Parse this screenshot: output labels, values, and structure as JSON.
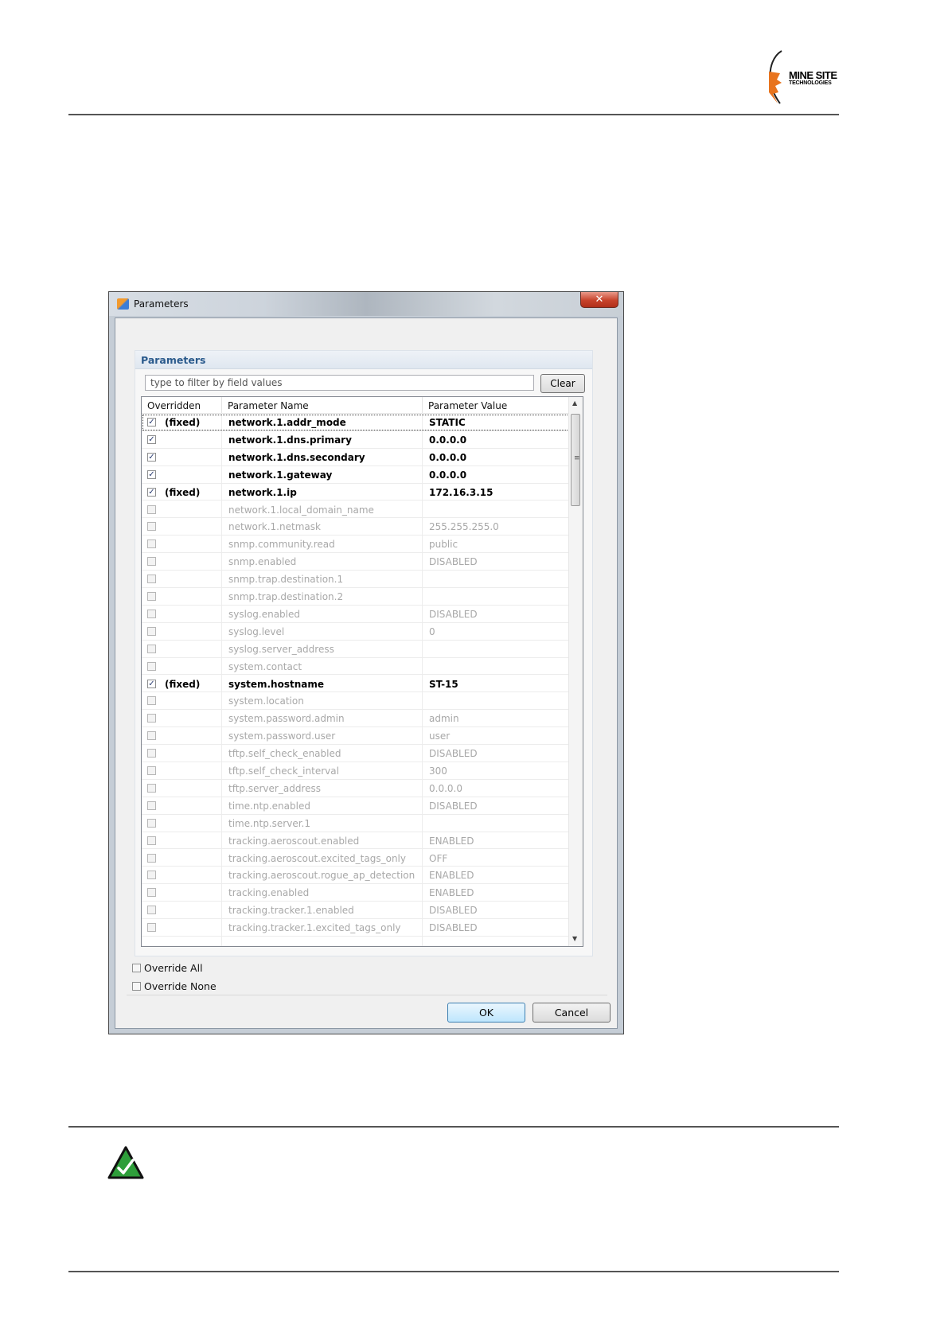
{
  "logo": {
    "line1": "MINE SITE",
    "line2": "TECHNOLOGIES"
  },
  "dialog": {
    "window_title": "Parameters",
    "close_glyph": "✕",
    "panel_title": "Parameters",
    "filter_placeholder": "type to filter by field values",
    "clear_label": "Clear",
    "columns": [
      "Overridden",
      "Parameter Name",
      "Parameter Value"
    ],
    "rows": [
      {
        "checked": true,
        "fixed": "(fixed)",
        "name": "network.1.addr_mode",
        "value": "STATIC"
      },
      {
        "checked": true,
        "fixed": "",
        "name": "network.1.dns.primary",
        "value": "0.0.0.0"
      },
      {
        "checked": true,
        "fixed": "",
        "name": "network.1.dns.secondary",
        "value": "0.0.0.0"
      },
      {
        "checked": true,
        "fixed": "",
        "name": "network.1.gateway",
        "value": "0.0.0.0"
      },
      {
        "checked": true,
        "fixed": "(fixed)",
        "name": "network.1.ip",
        "value": "172.16.3.15"
      },
      {
        "checked": false,
        "fixed": "",
        "name": "network.1.local_domain_name",
        "value": ""
      },
      {
        "checked": false,
        "fixed": "",
        "name": "network.1.netmask",
        "value": "255.255.255.0"
      },
      {
        "checked": false,
        "fixed": "",
        "name": "snmp.community.read",
        "value": "public"
      },
      {
        "checked": false,
        "fixed": "",
        "name": "snmp.enabled",
        "value": "DISABLED"
      },
      {
        "checked": false,
        "fixed": "",
        "name": "snmp.trap.destination.1",
        "value": ""
      },
      {
        "checked": false,
        "fixed": "",
        "name": "snmp.trap.destination.2",
        "value": ""
      },
      {
        "checked": false,
        "fixed": "",
        "name": "syslog.enabled",
        "value": "DISABLED"
      },
      {
        "checked": false,
        "fixed": "",
        "name": "syslog.level",
        "value": "0"
      },
      {
        "checked": false,
        "fixed": "",
        "name": "syslog.server_address",
        "value": ""
      },
      {
        "checked": false,
        "fixed": "",
        "name": "system.contact",
        "value": ""
      },
      {
        "checked": true,
        "fixed": "(fixed)",
        "name": "system.hostname",
        "value": "ST-15"
      },
      {
        "checked": false,
        "fixed": "",
        "name": "system.location",
        "value": ""
      },
      {
        "checked": false,
        "fixed": "",
        "name": "system.password.admin",
        "value": "admin"
      },
      {
        "checked": false,
        "fixed": "",
        "name": "system.password.user",
        "value": "user"
      },
      {
        "checked": false,
        "fixed": "",
        "name": "tftp.self_check_enabled",
        "value": "DISABLED"
      },
      {
        "checked": false,
        "fixed": "",
        "name": "tftp.self_check_interval",
        "value": "300"
      },
      {
        "checked": false,
        "fixed": "",
        "name": "tftp.server_address",
        "value": "0.0.0.0"
      },
      {
        "checked": false,
        "fixed": "",
        "name": "time.ntp.enabled",
        "value": "DISABLED"
      },
      {
        "checked": false,
        "fixed": "",
        "name": "time.ntp.server.1",
        "value": ""
      },
      {
        "checked": false,
        "fixed": "",
        "name": "tracking.aeroscout.enabled",
        "value": "ENABLED"
      },
      {
        "checked": false,
        "fixed": "",
        "name": "tracking.aeroscout.excited_tags_only",
        "value": "OFF"
      },
      {
        "checked": false,
        "fixed": "",
        "name": "tracking.aeroscout.rogue_ap_detection",
        "value": "ENABLED"
      },
      {
        "checked": false,
        "fixed": "",
        "name": "tracking.enabled",
        "value": "ENABLED"
      },
      {
        "checked": false,
        "fixed": "",
        "name": "tracking.tracker.1.enabled",
        "value": "DISABLED"
      },
      {
        "checked": false,
        "fixed": "",
        "name": "tracking.tracker.1.excited_tags_only",
        "value": "DISABLED"
      }
    ],
    "override_all_label": "Override All",
    "override_none_label": "Override None",
    "ok_label": "OK",
    "cancel_label": "Cancel"
  },
  "colors": {
    "brand_orange": "#e8741e",
    "link_blue": "#2a5a8c",
    "note_green": "#2e9e3a"
  }
}
